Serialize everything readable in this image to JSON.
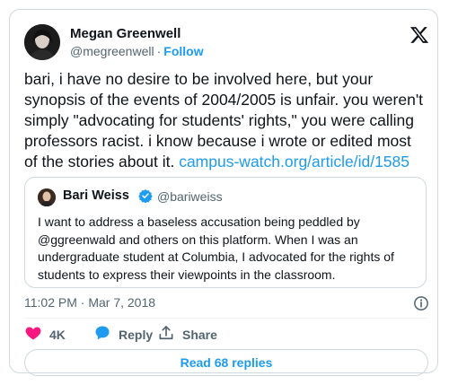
{
  "author": {
    "name": "Megan Greenwell",
    "handle": "@megreenwell",
    "separator": "·",
    "follow_label": "Follow"
  },
  "tweet": {
    "text": "bari, i have no desire to be involved here, but your synopsis of the events of 2004/2005 is unfair. you weren't simply \"advocating for students' rights,\" you were calling professors racist. i know because i wrote or edited most of the stories about it.",
    "link": "campus-watch.org/article/id/1585"
  },
  "quoted": {
    "name": "Bari Weiss",
    "handle": "@bariweiss",
    "text": "I want to address a baseless accusation being peddled by @ggreenwald and others on this platform. When I was an undergraduate student at Columbia, I advocated for the rights of students to express their viewpoints in the classroom."
  },
  "timestamp": "11:02 PM · Mar 7, 2018",
  "actions": {
    "likes_count": "4K",
    "reply_label": "Reply",
    "share_label": "Share"
  },
  "read_replies_label": "Read 68 replies",
  "colors": {
    "accent": "#1d9bf0",
    "like": "#f91880",
    "text": "#0f1419",
    "muted": "#536471",
    "border": "#cfd9de"
  },
  "icons": [
    "x-logo-icon",
    "verified-badge-icon",
    "info-icon",
    "heart-icon",
    "reply-bubble-icon",
    "share-icon"
  ]
}
